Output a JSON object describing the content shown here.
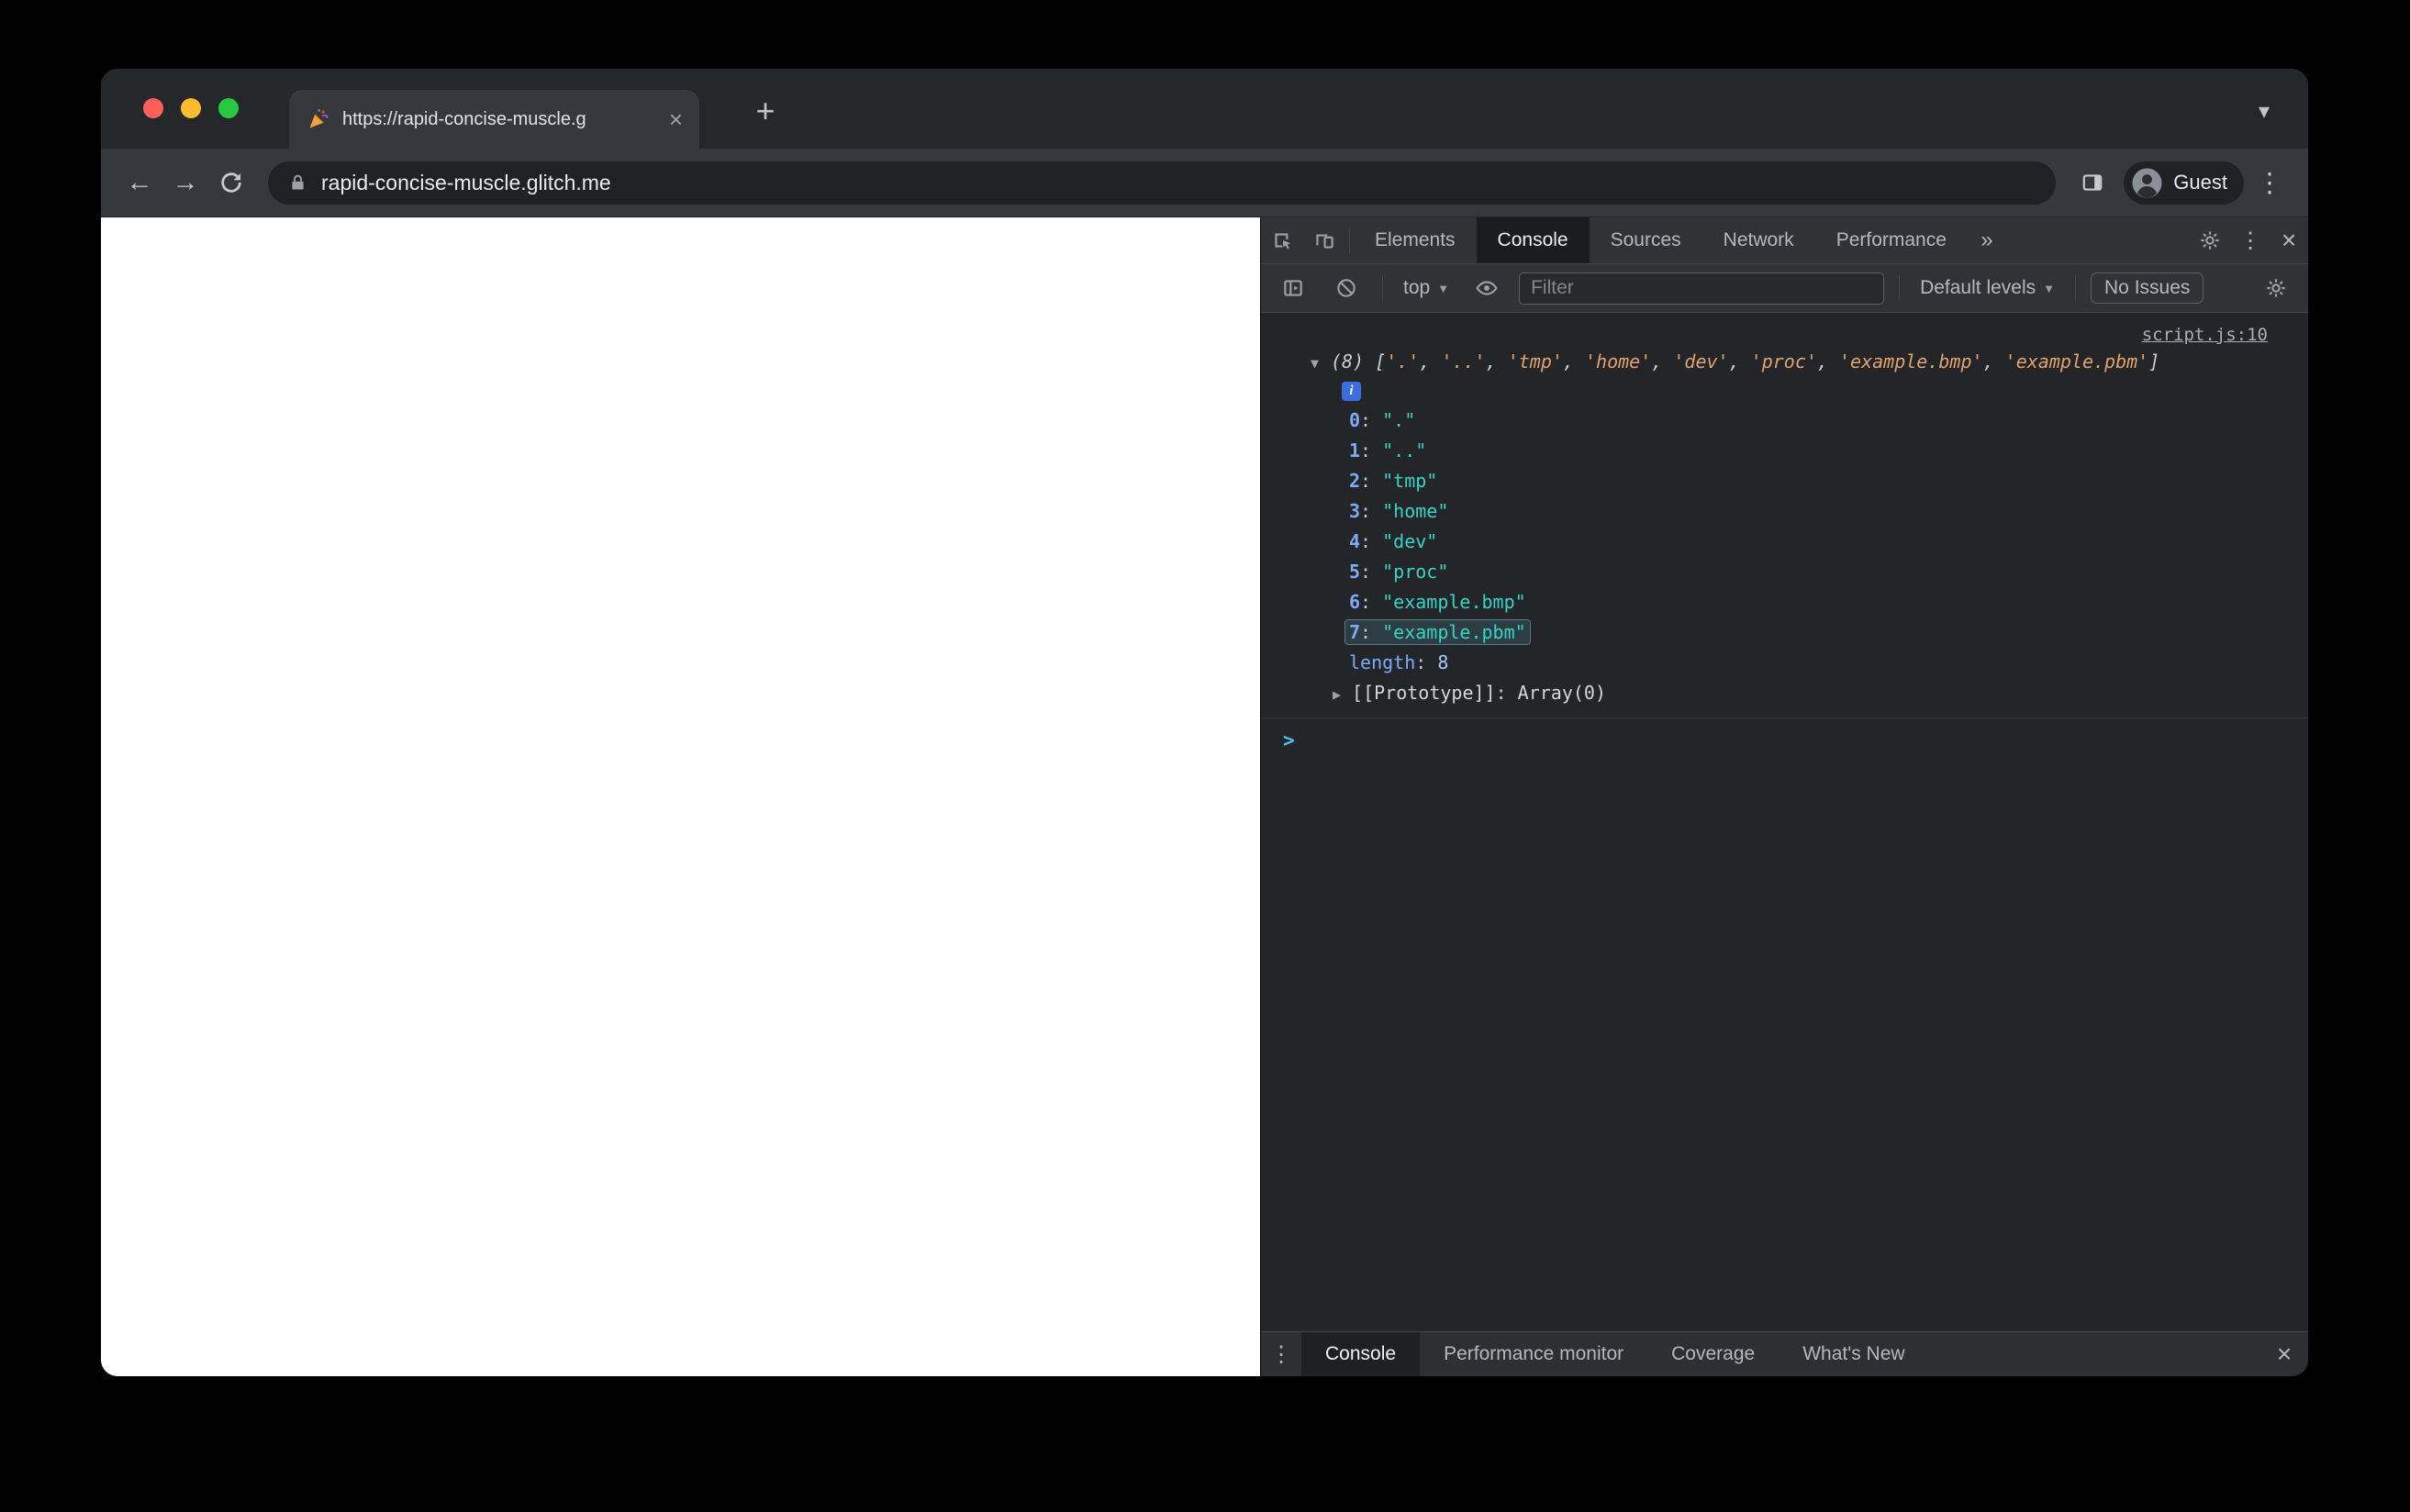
{
  "browser": {
    "tab_title": "https://rapid-concise-muscle.g",
    "url": "rapid-concise-muscle.glitch.me",
    "profile_label": "Guest"
  },
  "devtools": {
    "tabs": [
      "Elements",
      "Console",
      "Sources",
      "Network",
      "Performance"
    ],
    "active_tab": "Console",
    "toolbar": {
      "context_label": "top",
      "filter_placeholder": "Filter",
      "levels_label": "Default levels",
      "issues_label": "No Issues"
    },
    "console": {
      "source_link": "script.js:10",
      "array_length": 8,
      "items": [
        ".",
        "..",
        "tmp",
        "home",
        "dev",
        "proc",
        "example.bmp",
        "example.pbm"
      ],
      "highlight_index": 7,
      "info_icon": "i",
      "length_label": "length",
      "length_value": "8",
      "prototype_label": "[[Prototype]]",
      "prototype_value": "Array(0)",
      "prompt_char": ">"
    },
    "drawer": {
      "tabs": [
        "Console",
        "Performance monitor",
        "Coverage",
        "What's New"
      ],
      "active_tab": "Console"
    }
  },
  "glyphs": {
    "close": "×",
    "plus": "+",
    "back": "←",
    "forward": "→",
    "chevron_down": "▾",
    "caret_down": "▼",
    "caret_right": "▶",
    "more_tabs": "»",
    "kebab": "⋮"
  },
  "colors": {
    "string_preview": "#e0a36e",
    "string_value": "#35d4c7",
    "property_index": "#7cacf8",
    "number_value": "#a8c7fa",
    "prompt_chevron": "#4fc0e8",
    "highlight_border": "#4e7e8a",
    "info_badge": "#3b6ce0",
    "traffic_red": "#ff5f57",
    "traffic_yellow": "#febc2e",
    "traffic_green": "#28c840"
  }
}
